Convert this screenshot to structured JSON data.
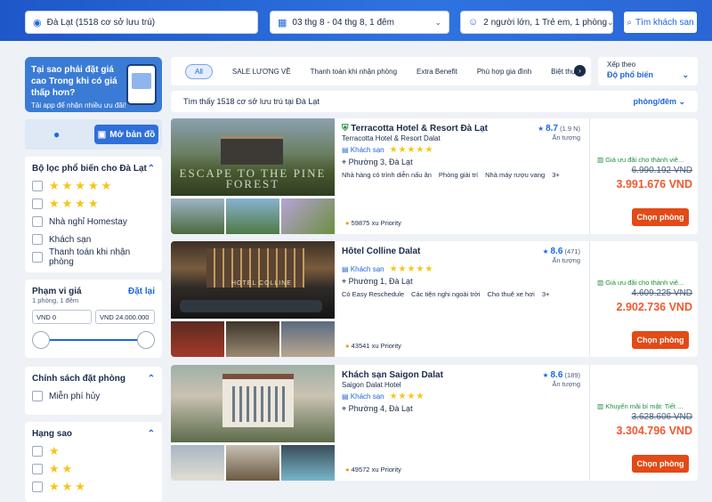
{
  "search": {
    "location": "Đà Lạt (1518 cơ sở lưu trú)",
    "dates": "03 thg 8 - 04 thg 8, 1 đêm",
    "guests": "2 người lớn, 1 Trẻ em, 1 phòng",
    "button": "Tìm khách san"
  },
  "promo": {
    "title": "Tại sao phải đặt giá cao Trong khi có giá thấp hơn?",
    "subtitle": "Tải app để nhận nhiều ưu đãi!"
  },
  "map": {
    "button": "Mở bản đồ"
  },
  "popular_filters": {
    "title": "Bộ lọc phổ biến cho Đà Lạt",
    "options": [
      "Nhà nghỉ Homestay",
      "Khách sạn",
      "Thanh toán khi nhận phòng"
    ]
  },
  "price_range": {
    "title": "Phạm vi giá",
    "reset": "Đặt lại",
    "sub": "1 phòng, 1 đêm",
    "min": "VND 0",
    "max": "VND 24.000.000"
  },
  "booking_policy": {
    "title": "Chính sách đặt phòng",
    "options": [
      "Miễn phí hủy"
    ]
  },
  "star_rating": {
    "title": "Hạng sao"
  },
  "tabs": [
    "All",
    "SALE LƯƠNG VỀ",
    "Thanh toán khi nhận phòng",
    "Extra Benefit",
    "Phù hợp gia đình",
    "Biệt thự và"
  ],
  "sort": {
    "label": "Xếp theo",
    "value": "Độ phổ biến"
  },
  "results": {
    "found": "Tìm thấy 1518 cơ sở lưu trú tại Đà Lạt",
    "price_unit": "phòng/đêm"
  },
  "hotels": [
    {
      "name": "Terracotta Hotel & Resort Đà Lạt",
      "subname": "Terracotta Hotel & Resort Dalat",
      "type": "Khách sạn",
      "stars": 5,
      "location": "Phường 3, Đà Lạt",
      "tags": [
        "Nhà hàng có trình diễn nấu ăn",
        "Phòng giải trí",
        "Nhà máy rượu vang",
        "3+"
      ],
      "points": "59875 xu Priority",
      "score": "8.7",
      "reviews": "(1.9 N)",
      "rating_text": "Ấn tượng",
      "deal": "Giá ưu đãi cho thành viê...",
      "old_price": "6.990.192 VND",
      "price": "3.991.676 VND",
      "button": "Chọn phòng",
      "image_text": "ESCAPE TO THE PINE FOREST"
    },
    {
      "name": "Hôtel Colline Dalat",
      "subname": "",
      "type": "Khách sạn",
      "stars": 5,
      "location": "Phường 1, Đà Lạt",
      "tags": [
        "Có Easy Reschedule",
        "Các tiện nghi ngoài trời",
        "Cho thuê xe hơi",
        "3+"
      ],
      "points": "43541 xu Priority",
      "score": "8.6",
      "reviews": "(471)",
      "rating_text": "Ấn tượng",
      "deal": "Giá ưu đãi cho thành viê...",
      "old_price": "4.609.225 VND",
      "price": "2.902.736 VND",
      "button": "Chọn phòng",
      "image_text": "HOTEL COLLINE"
    },
    {
      "name": "Khách sạn Saigon Dalat",
      "subname": "Saigon Dalat Hotel",
      "type": "Khách sạn",
      "stars": 4,
      "location": "Phường 4, Đà Lạt",
      "tags": [],
      "points": "49572 xu Priority",
      "score": "8.6",
      "reviews": "(189)",
      "rating_text": "Ấn tượng",
      "deal": "Khuyến mãi bí mật: Tiết ...",
      "old_price": "3.628.606 VND",
      "price": "3.304.796 VND",
      "button": "Chọn phòng",
      "image_text": ""
    }
  ]
}
